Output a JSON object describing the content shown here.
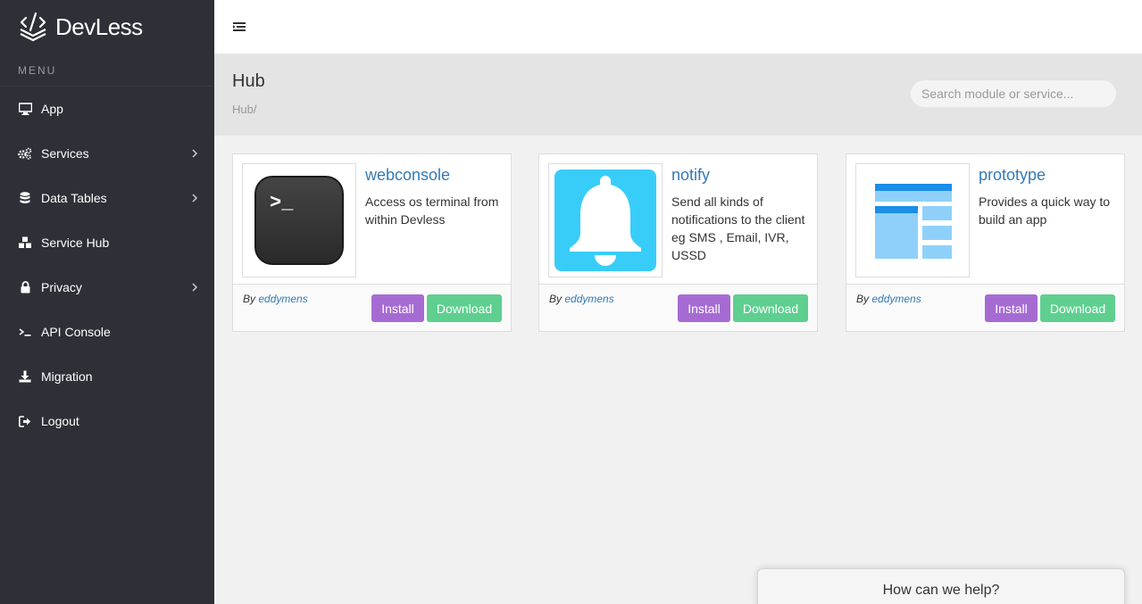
{
  "brand": {
    "name": "DevLess"
  },
  "sidebar": {
    "menu_heading": "MENU",
    "items": [
      {
        "label": "App",
        "icon": "monitor-icon",
        "has_submenu": false
      },
      {
        "label": "Services",
        "icon": "cogs-icon",
        "has_submenu": true
      },
      {
        "label": "Data Tables",
        "icon": "database-icon",
        "has_submenu": true
      },
      {
        "label": "Service Hub",
        "icon": "cubes-icon",
        "has_submenu": false
      },
      {
        "label": "Privacy",
        "icon": "lock-icon",
        "has_submenu": true
      },
      {
        "label": "API Console",
        "icon": "terminal-icon",
        "has_submenu": false
      },
      {
        "label": "Migration",
        "icon": "download-icon",
        "has_submenu": false
      },
      {
        "label": "Logout",
        "icon": "sign-out-icon",
        "has_submenu": false
      }
    ]
  },
  "header": {
    "title": "Hub",
    "breadcrumb": "Hub/",
    "search_placeholder": "Search module or service..."
  },
  "cards": [
    {
      "name": "webconsole",
      "description": "Access os terminal from within Devless",
      "by_label": "By",
      "author": "eddymens",
      "install_label": "Install",
      "download_label": "Download",
      "icon": "terminal-app-icon"
    },
    {
      "name": "notify",
      "description": "Send all kinds of notifications to the client eg SMS , Email, IVR, USSD",
      "by_label": "By",
      "author": "eddymens",
      "install_label": "Install",
      "download_label": "Download",
      "icon": "bell-icon"
    },
    {
      "name": "prototype",
      "description": "Provides a quick way to build an app",
      "by_label": "By",
      "author": "eddymens",
      "install_label": "Install",
      "download_label": "Download",
      "icon": "layout-icon"
    }
  ],
  "help_widget": {
    "label": "How can we help?"
  },
  "colors": {
    "sidebar_bg": "#2f2f37",
    "install_button": "#a66bd3",
    "download_button": "#5ecf8f",
    "link": "#337ab7",
    "notify_icon_bg": "#38cdf9",
    "prototype_dark": "#1a8ee8",
    "prototype_light": "#8fd0fa"
  }
}
